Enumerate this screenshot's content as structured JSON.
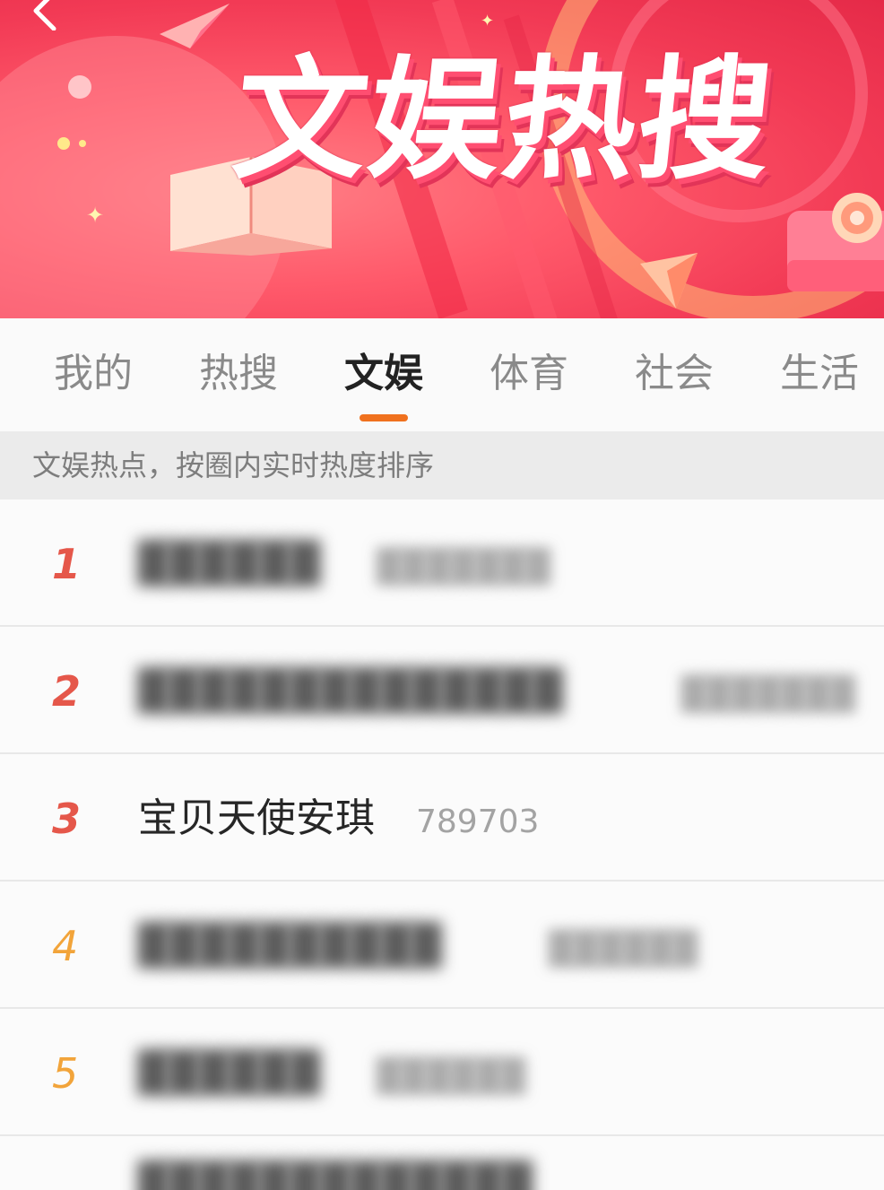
{
  "banner": {
    "title": "文娱热搜",
    "colors": {
      "base": "#f23a55",
      "accent_orange": "#f0711e"
    }
  },
  "navigation": {
    "back_icon": "chevron-left-icon"
  },
  "tabs": [
    {
      "label": "我的",
      "active": false
    },
    {
      "label": "热搜",
      "active": false
    },
    {
      "label": "文娱",
      "active": true
    },
    {
      "label": "体育",
      "active": false
    },
    {
      "label": "社会",
      "active": false
    },
    {
      "label": "生活",
      "active": false
    }
  ],
  "subtitle": "文娱热点，按圈内实时热度排序",
  "list": [
    {
      "rank": "1",
      "title": "",
      "count": "",
      "blurred": true
    },
    {
      "rank": "2",
      "title": "",
      "count": "",
      "blurred": true
    },
    {
      "rank": "3",
      "title": "宝贝天使安琪",
      "count": "789703",
      "blurred": false
    },
    {
      "rank": "4",
      "title": "",
      "count": "",
      "blurred": true
    },
    {
      "rank": "5",
      "title": "",
      "count": "",
      "blurred": true
    }
  ]
}
